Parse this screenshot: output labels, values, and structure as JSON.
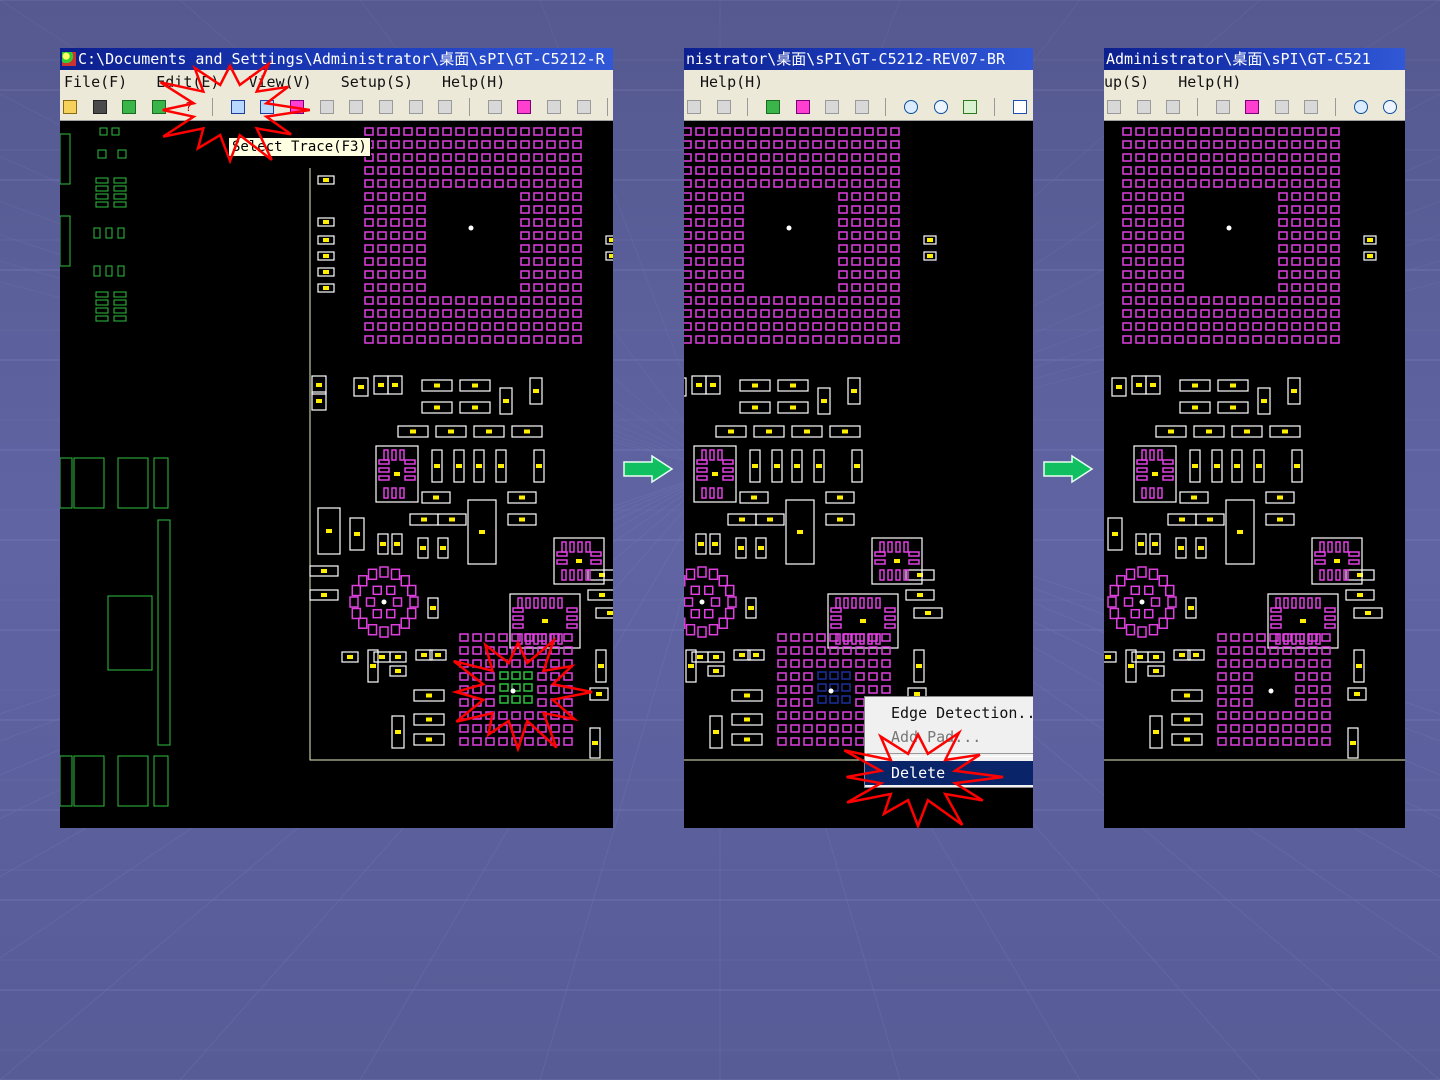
{
  "colors": {
    "background": "#5a5e98",
    "pad_magenta": "#e040e0",
    "pad_white": "#ffffff",
    "pad_yellow": "#ffee00",
    "trace_green": "#2fbf3f",
    "selection_blue": "#1b2f9a",
    "burst_red": "#ff0000",
    "arrow_green": "#10c060"
  },
  "panels": [
    {
      "title": "C:\\Documents and Settings\\Administrator\\桌面\\sPI\\GT-C5212-R",
      "menu": [
        "File(F)",
        "Edit(E)",
        "View(V)",
        "Setup(S)",
        "Help(H)"
      ],
      "tooltip": "Select Trace(F3)"
    },
    {
      "title": "nistrator\\桌面\\sPI\\GT-C5212-REV07-BR",
      "menu": [
        "Help(H)"
      ],
      "context_menu": {
        "items": [
          "Edge Detection...",
          "Add Pad...",
          "Delete"
        ],
        "highlighted": "Delete"
      }
    },
    {
      "title": "Administrator\\桌面\\sPI\\GT-C521",
      "menu": [
        "up(S)",
        "Help(H)"
      ]
    }
  ]
}
